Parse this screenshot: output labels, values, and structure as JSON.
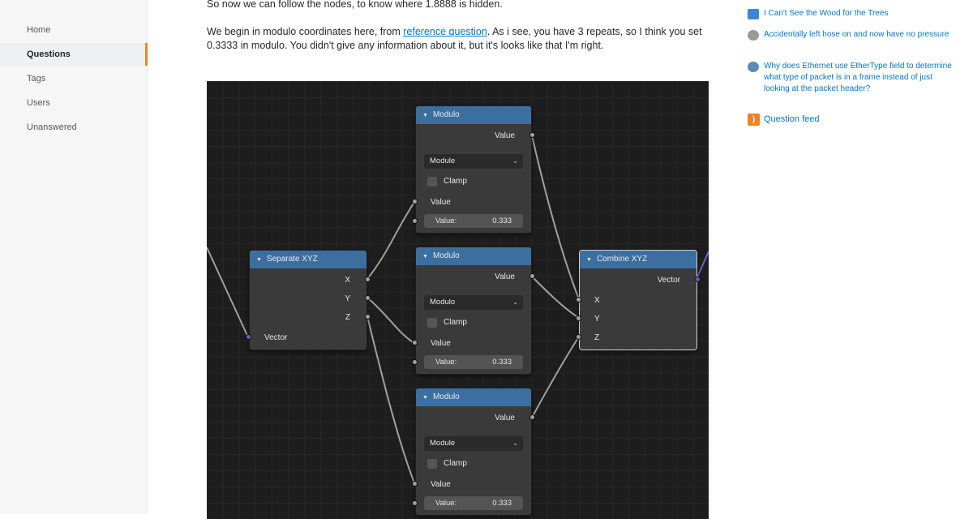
{
  "sidebar": {
    "items": [
      {
        "label": "Home"
      },
      {
        "label": "Questions",
        "active": true
      },
      {
        "label": "Tags"
      },
      {
        "label": "Users"
      },
      {
        "label": "Unanswered"
      }
    ]
  },
  "post": {
    "line_top": "So now we can follow the nodes, to know where 1.8888 is hidden.",
    "para_before_link": "We begin in modulo coordinates here, from ",
    "link_text": "reference question",
    "para_after_link": ". As i see, you have 3 repeats, so I think you set 0.3333 in modulo. You didn't give any information about it, but it's looks like that I'm right."
  },
  "node_editor": {
    "separate": {
      "title": "Separate XYZ",
      "outputs": [
        "X",
        "Y",
        "Z"
      ],
      "input": "Vector"
    },
    "modulo_nodes": [
      {
        "title": "Modulo",
        "output": "Value",
        "operation": "Module",
        "clamp": "Clamp",
        "input": "Value",
        "field_label": "Value:",
        "field_value": "0.333"
      },
      {
        "title": "Modulo",
        "output": "Value",
        "operation": "Modulo",
        "clamp": "Clamp",
        "input": "Value",
        "field_label": "Value:",
        "field_value": "0.333"
      },
      {
        "title": "Modulo",
        "output": "Value",
        "operation": "Module",
        "clamp": "Clamp",
        "input": "Value",
        "field_label": "Value:",
        "field_value": "0.333"
      }
    ],
    "combine": {
      "title": "Combine XYZ",
      "output": "Vector",
      "inputs": [
        "X",
        "Y",
        "Z"
      ]
    }
  },
  "hot_questions": [
    {
      "title": "I Can't See the Wood for the Trees",
      "icon": "site-icon-blue"
    },
    {
      "title": "Accidentally left hose on and now have no pressure",
      "icon": "site-icon-gray"
    },
    {
      "title": "Why does Ethernet use EtherType field to determine what type of packet is in a frame instead of just looking at the packet header?",
      "icon": "site-icon-network"
    }
  ],
  "feed": {
    "label": "Question feed",
    "icon": "rss-icon"
  },
  "colors": {
    "accent": "#f48024",
    "link": "#0077cc",
    "node_header": "#3b6fa0"
  }
}
